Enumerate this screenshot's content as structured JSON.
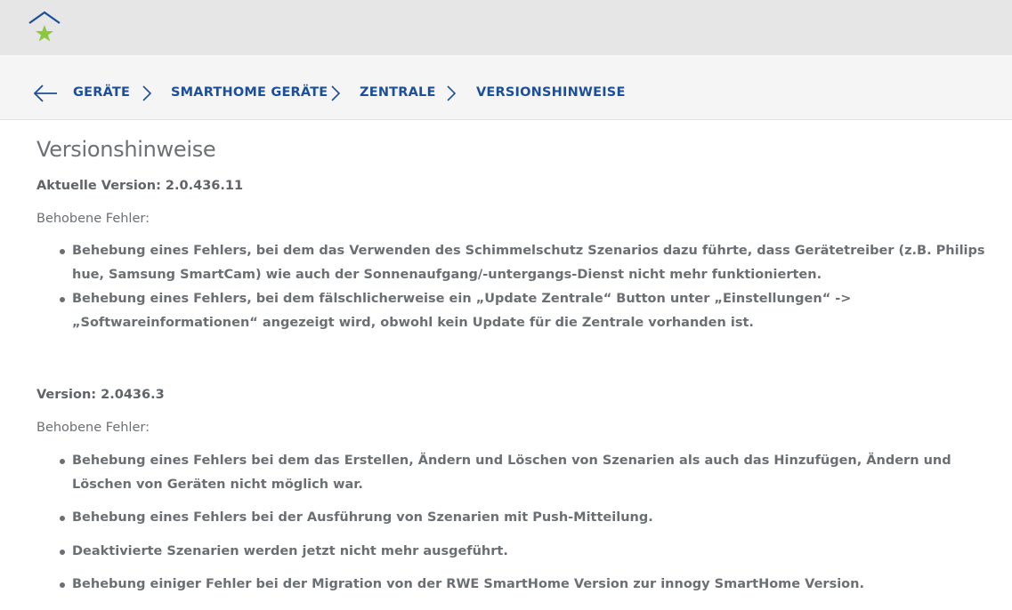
{
  "header": {
    "logo_icon": "house-star-icon",
    "logo_roof_color": "#1c4f99",
    "logo_star_color": "#8dc63f"
  },
  "breadcrumb": {
    "back_icon": "arrow-left-icon",
    "items": [
      {
        "label": "GERÄTE"
      },
      {
        "label": "SMARTHOME GERÄTE"
      },
      {
        "label": "ZENTRALE"
      },
      {
        "label": "VERSIONSHINWEISE"
      }
    ],
    "separator_icon": "chevron-right-icon",
    "link_color": "#1c4f99"
  },
  "main": {
    "title": "Versionshinweise",
    "sections": [
      {
        "heading": "Aktuelle Version: 2.0.436.11",
        "label": "Behobene Fehler:",
        "items": [
          "Behebung eines Fehlers, bei dem das Verwenden des Schimmelschutz Szenarios dazu führte, dass Gerätetreiber (z.B. Philips hue, Samsung SmartCam) wie auch der Sonnenaufgang/-untergangs-Dienst nicht mehr funktionierten.",
          "Behebung eines Fehlers, bei dem fälschlicherweise ein „Update Zentrale“ Button unter „Einstellungen“ -> „Softwareinformationen“ angezeigt wird, obwohl kein Update für die Zentrale vorhanden ist."
        ]
      },
      {
        "heading": "Version: 2.0436.3",
        "label": "Behobene Fehler:",
        "items": [
          "Behebung eines Fehlers bei dem das Erstellen, Ändern und Löschen von Szenarien als auch das Hinzufügen, Ändern und Löschen von Geräten nicht möglich war.",
          "Behebung eines Fehlers bei der Ausführung von Szenarien mit Push-Mitteilung.",
          "Deaktivierte Szenarien werden jetzt nicht mehr ausgeführt.",
          "Behebung einiger Fehler bei der Migration von der RWE SmartHome Version zur innogy SmartHome Version."
        ]
      }
    ]
  }
}
